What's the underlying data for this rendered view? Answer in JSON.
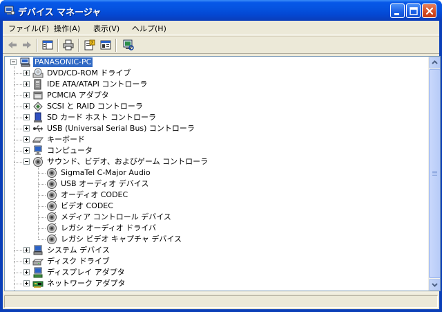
{
  "window": {
    "title": "デバイス マネージャ",
    "icon": "device-manager-icon"
  },
  "menubar": {
    "items": [
      {
        "label": "ファイル(F)",
        "name": "menu-file"
      },
      {
        "label": "操作(A)",
        "name": "menu-action"
      },
      {
        "label": "表示(V)",
        "name": "menu-view"
      },
      {
        "label": "ヘルプ(H)",
        "name": "menu-help"
      }
    ]
  },
  "toolbar": {
    "buttons": [
      "back-icon",
      "forward-icon",
      "show-hide-tree-icon",
      "print-icon",
      "properties-icon",
      "help-icon",
      "scan-hardware-icon"
    ]
  },
  "tree": {
    "root": {
      "label": "PANASONIC-PC",
      "icon": "computer-icon",
      "selected": true
    },
    "items": [
      {
        "label": "DVD/CD-ROM ドライブ",
        "icon": "cdrom-icon",
        "expanded": false
      },
      {
        "label": "IDE ATA/ATAPI コントローラ",
        "icon": "ide-controller-icon",
        "expanded": false
      },
      {
        "label": "PCMCIA アダプタ",
        "icon": "pcmcia-icon",
        "expanded": false
      },
      {
        "label": "SCSI と RAID コントローラ",
        "icon": "scsi-icon",
        "expanded": false
      },
      {
        "label": "SD カード ホスト コントローラ",
        "icon": "sd-card-icon",
        "expanded": false
      },
      {
        "label": "USB (Universal Serial Bus) コントローラ",
        "icon": "usb-icon",
        "expanded": false
      },
      {
        "label": "キーボード",
        "icon": "keyboard-icon",
        "expanded": false
      },
      {
        "label": "コンピュータ",
        "icon": "computer-monitor-icon",
        "expanded": false
      },
      {
        "label": "サウンド、ビデオ、およびゲーム コントローラ",
        "icon": "speaker-icon",
        "expanded": true,
        "children": [
          {
            "label": "SigmaTel C-Major Audio",
            "icon": "speaker-icon"
          },
          {
            "label": "USB オーディオ デバイス",
            "icon": "speaker-icon"
          },
          {
            "label": "オーディオ CODEC",
            "icon": "speaker-icon"
          },
          {
            "label": "ビデオ CODEC",
            "icon": "speaker-icon"
          },
          {
            "label": "メディア コントロール デバイス",
            "icon": "speaker-icon"
          },
          {
            "label": "レガシ オーディオ ドライバ",
            "icon": "speaker-icon"
          },
          {
            "label": "レガシ ビデオ キャプチャ デバイス",
            "icon": "speaker-icon"
          }
        ]
      },
      {
        "label": "システム デバイス",
        "icon": "system-device-icon",
        "expanded": false
      },
      {
        "label": "ディスク ドライブ",
        "icon": "disk-drive-icon",
        "expanded": false
      },
      {
        "label": "ディスプレイ アダプタ",
        "icon": "display-adapter-icon",
        "expanded": false
      },
      {
        "label": "ネットワーク アダプタ",
        "icon": "network-adapter-icon",
        "expanded": false
      }
    ]
  },
  "colors": {
    "selection": "#316ac5",
    "titlebar": "#0553e0",
    "chrome": "#ece9d8"
  }
}
